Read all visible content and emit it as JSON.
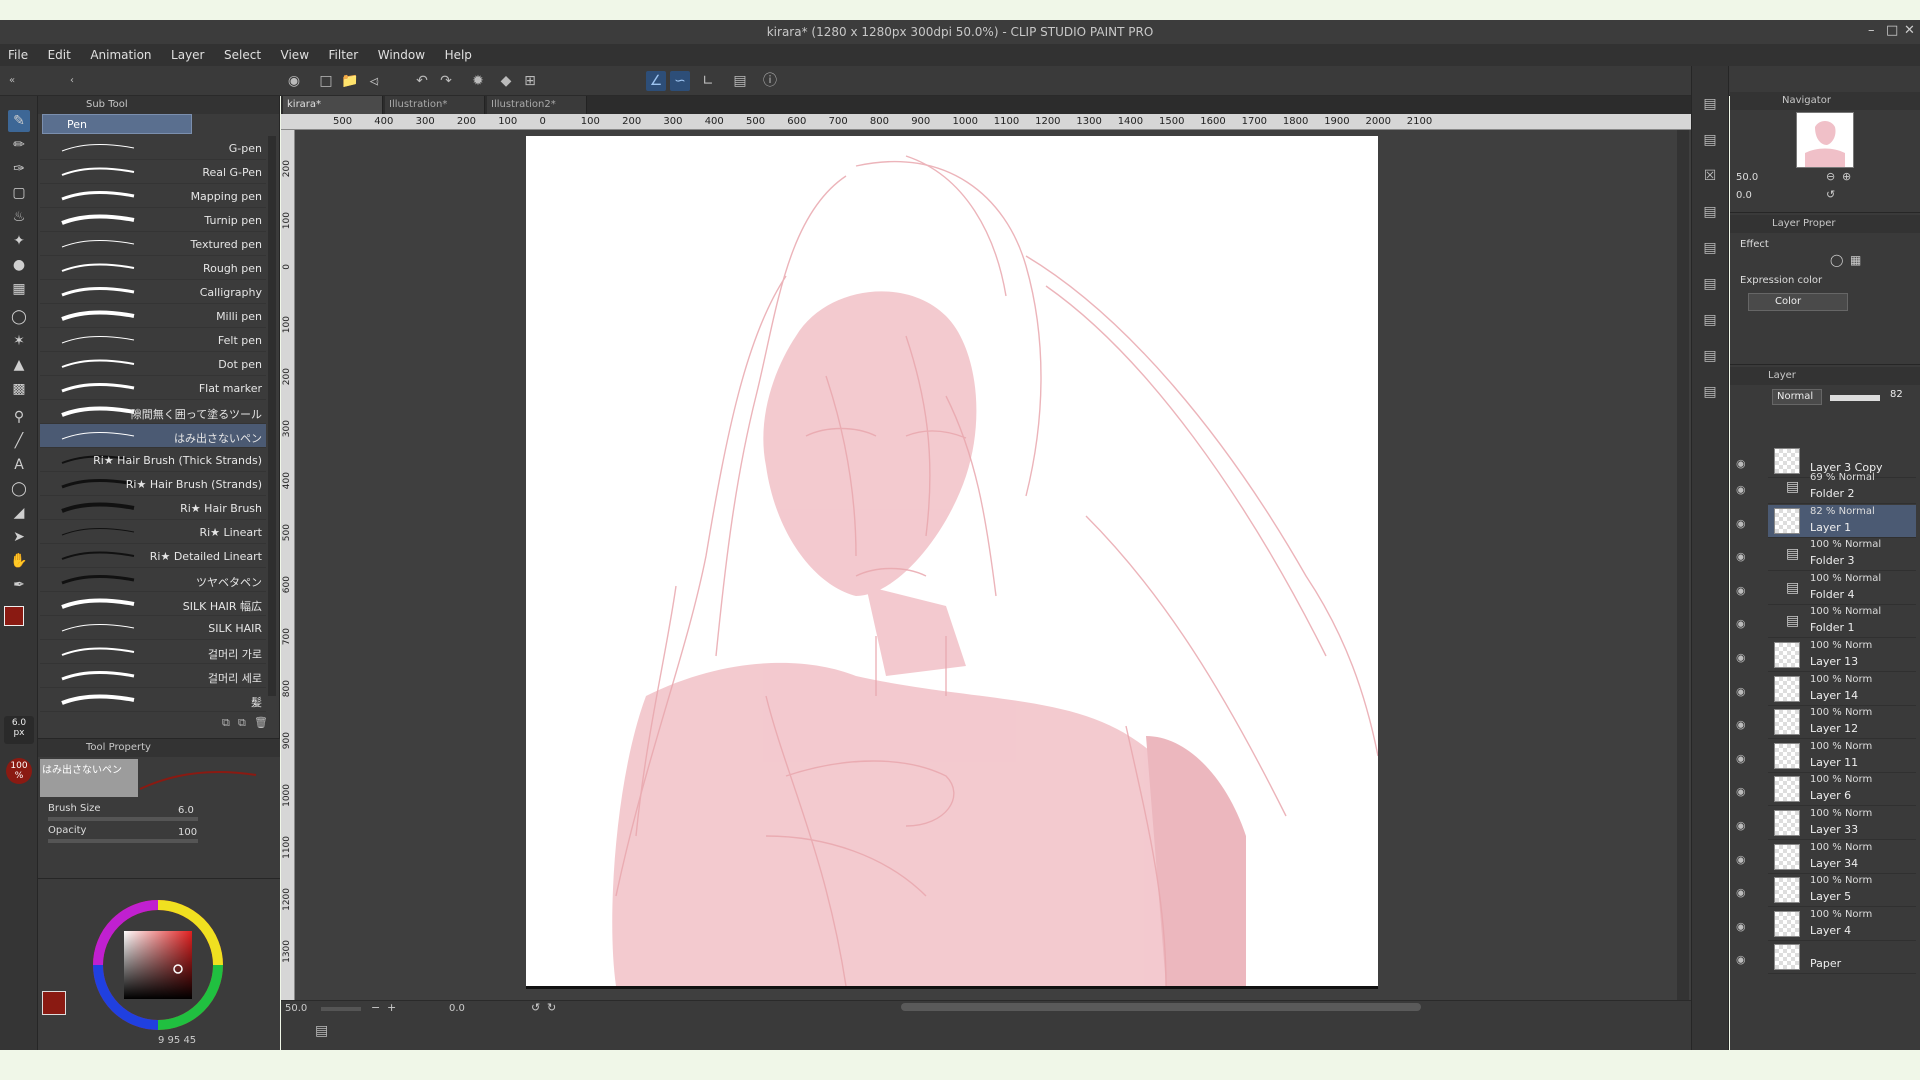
{
  "window": {
    "title": "kirara* (1280 x 1280px 300dpi 50.0%)  - CLIP STUDIO PAINT PRO"
  },
  "menu": [
    "File",
    "Edit",
    "Animation",
    "Layer",
    "Select",
    "View",
    "Filter",
    "Window",
    "Help"
  ],
  "subtool": {
    "header": "Sub Tool",
    "group": "Pen",
    "brushes": [
      "G-pen",
      "Real G-Pen",
      "Mapping pen",
      "Turnip pen",
      "Textured pen",
      "Rough pen",
      "Calligraphy",
      "Milli pen",
      "Felt pen",
      "Dot pen",
      "Flat marker",
      "隙間無く囲って塗るツール",
      "はみ出さないペン",
      "Ri★ Hair Brush (Thick Strands)",
      "Ri★ Hair Brush (Strands)",
      "Ri★ Hair Brush",
      "Ri★ Lineart",
      "Ri★ Detailed Lineart",
      "ツヤベタペン",
      "SILK  HAIR  幅広",
      "SILK  HAIR",
      "걸머리 가로",
      "걸머리 세로",
      "髪"
    ],
    "selected_index": 12
  },
  "tool_property": {
    "header": "Tool Property",
    "preview_name": "はみ出さないペン",
    "brush_size_label": "Brush Size",
    "brush_size_value": "6.0",
    "opacity_label": "Opacity",
    "opacity_value": "100"
  },
  "brush_indicator": {
    "size": "6.0",
    "unit": "px",
    "opacity": "100",
    "opacity_unit": "%"
  },
  "color": {
    "main": "#8a1a12",
    "sub": "#ffffff",
    "readout": "9  95  45"
  },
  "doc_tabs": [
    "kirara*",
    "Illustration*",
    "Illustration2*"
  ],
  "ruler_h": [
    "500",
    "400",
    "300",
    "200",
    "100",
    "0",
    "100",
    "200",
    "300",
    "400",
    "500",
    "600",
    "700",
    "800",
    "900",
    "1000",
    "1100",
    "1200",
    "1300",
    "1400",
    "1500",
    "1600",
    "1700",
    "1800",
    "1900",
    "2000",
    "2100"
  ],
  "ruler_v": [
    "200",
    "100",
    "0",
    "100",
    "200",
    "300",
    "400",
    "500",
    "600",
    "700",
    "800",
    "900",
    "1000",
    "1100",
    "1200",
    "1300"
  ],
  "canvas_status": {
    "zoom": "50.0",
    "angle": "0.0"
  },
  "navigator": {
    "title": "Navigator",
    "zoom": "50.0",
    "angle": "0.0"
  },
  "layer_property": {
    "title": "Layer Proper",
    "effect_label": "Effect",
    "expression_label": "Expression color",
    "expression_value": "Color"
  },
  "layer_panel": {
    "title": "Layer",
    "blend_mode": "Normal",
    "opacity": "82",
    "layers": [
      {
        "pct": "",
        "name": "Layer 3 Copy",
        "folder": false
      },
      {
        "pct": "69 % Normal",
        "name": "Folder 2",
        "folder": true
      },
      {
        "pct": "82 % Normal",
        "name": "Layer 1",
        "folder": false,
        "selected": true
      },
      {
        "pct": "100 % Normal",
        "name": "Folder 3",
        "folder": true
      },
      {
        "pct": "100 % Normal",
        "name": "Folder 4",
        "folder": true
      },
      {
        "pct": "100 % Normal",
        "name": "Folder 1",
        "folder": true
      },
      {
        "pct": "100 % Norm",
        "name": "Layer 13",
        "folder": false
      },
      {
        "pct": "100 % Norm",
        "name": "Layer 14",
        "folder": false
      },
      {
        "pct": "100 % Norm",
        "name": "Layer 12",
        "folder": false
      },
      {
        "pct": "100 % Norm",
        "name": "Layer 11",
        "folder": false
      },
      {
        "pct": "100 % Norm",
        "name": "Layer 6",
        "folder": false
      },
      {
        "pct": "100 % Norm",
        "name": "Layer 33",
        "folder": false
      },
      {
        "pct": "100 % Norm",
        "name": "Layer 34",
        "folder": false
      },
      {
        "pct": "100 % Norm",
        "name": "Layer 5",
        "folder": false
      },
      {
        "pct": "100 % Norm",
        "name": "Layer 4",
        "folder": false
      },
      {
        "pct": "",
        "name": "Paper",
        "folder": false
      }
    ]
  },
  "accent": "#3d6796"
}
